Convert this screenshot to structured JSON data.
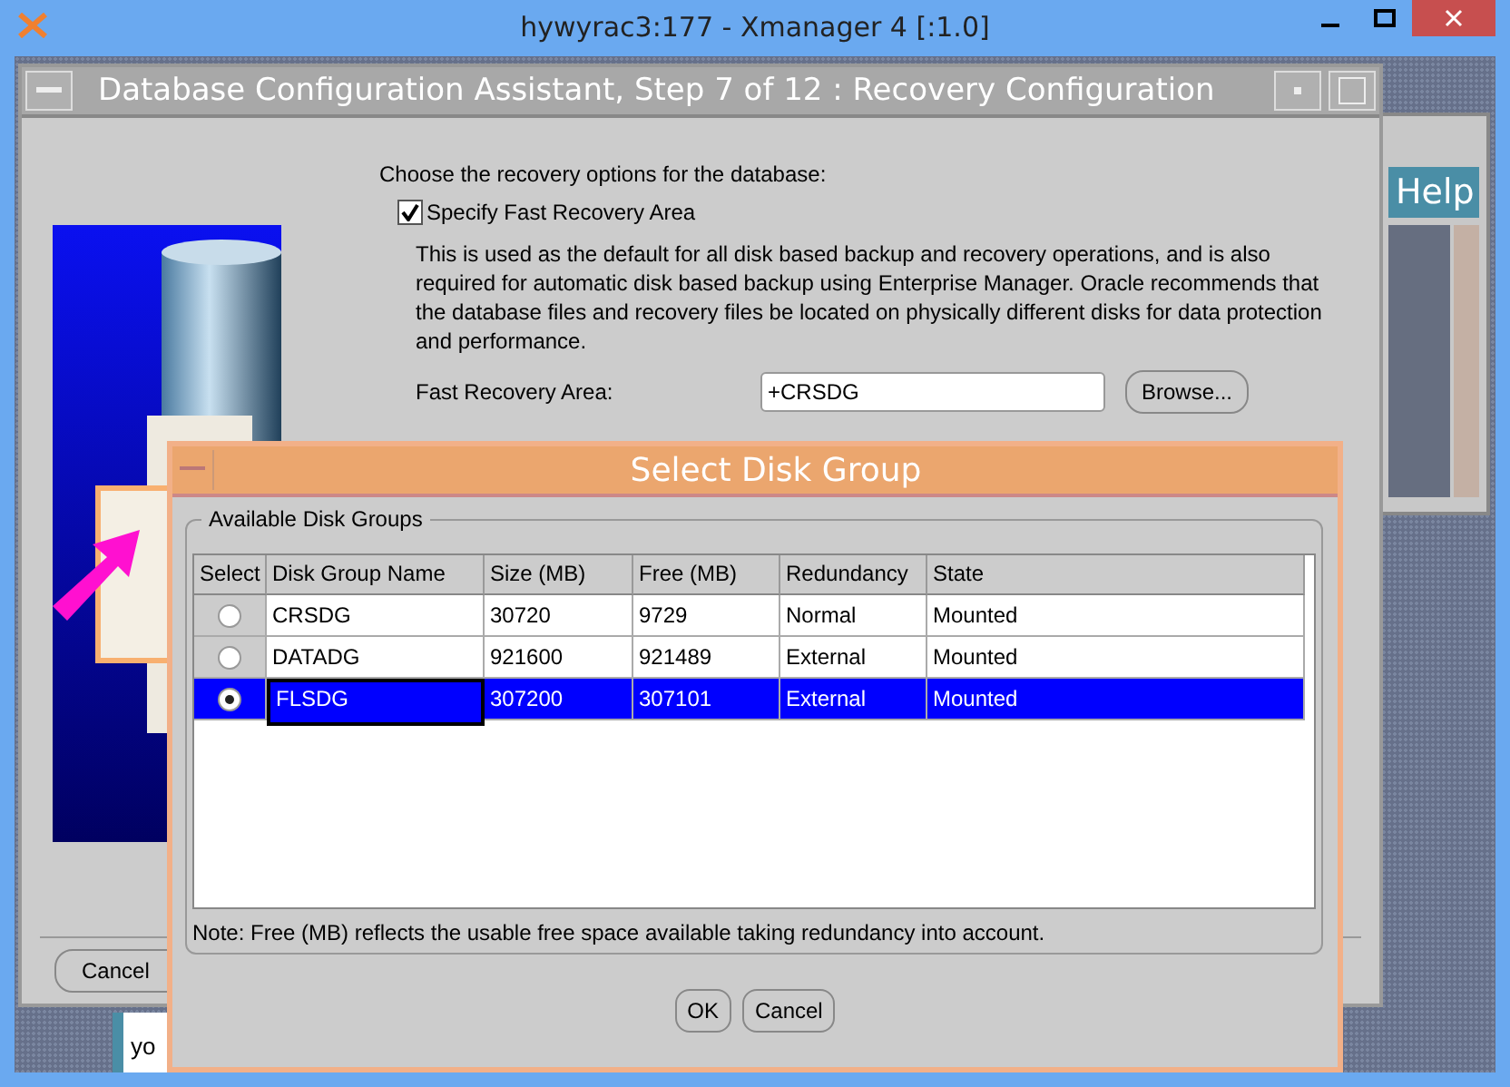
{
  "window": {
    "title": "hywyrac3:177 - Xmanager 4 [:1.0]"
  },
  "background_window": {
    "help_button": "Help",
    "fragment": "yo"
  },
  "assistant": {
    "title": "Database Configuration Assistant, Step 7 of 12 : Recovery Configuration",
    "intro": "Choose the recovery options for the database:",
    "fast_recovery": {
      "label": "Specify Fast Recovery Area",
      "checked": true
    },
    "description": "This is used as the default for all disk based backup and recovery operations, and is also required for automatic disk based backup using Enterprise Manager. Oracle recommends that the database files and recovery files be located on physically different disks for data protection and performance.",
    "area_label": "Fast Recovery Area:",
    "area_value": "+CRSDG",
    "browse_button": "Browse...",
    "cancel_button": "Cancel"
  },
  "dialog": {
    "title": "Select Disk Group",
    "group_label": "Available Disk Groups",
    "select_column": "Select",
    "columns": [
      "Disk Group Name",
      "Size (MB)",
      "Free (MB)",
      "Redundancy",
      "State"
    ],
    "rows": [
      {
        "selected": false,
        "cells": [
          "CRSDG",
          "30720",
          "9729",
          "Normal",
          "Mounted"
        ]
      },
      {
        "selected": false,
        "cells": [
          "DATADG",
          "921600",
          "921489",
          "External",
          "Mounted"
        ]
      },
      {
        "selected": true,
        "cells": [
          "FLSDG",
          "307200",
          "307101",
          "External",
          "Mounted"
        ]
      }
    ],
    "note": "Note:  Free (MB) reflects the usable free space available taking redundancy into account.",
    "buttons": [
      "OK",
      "Cancel"
    ]
  }
}
